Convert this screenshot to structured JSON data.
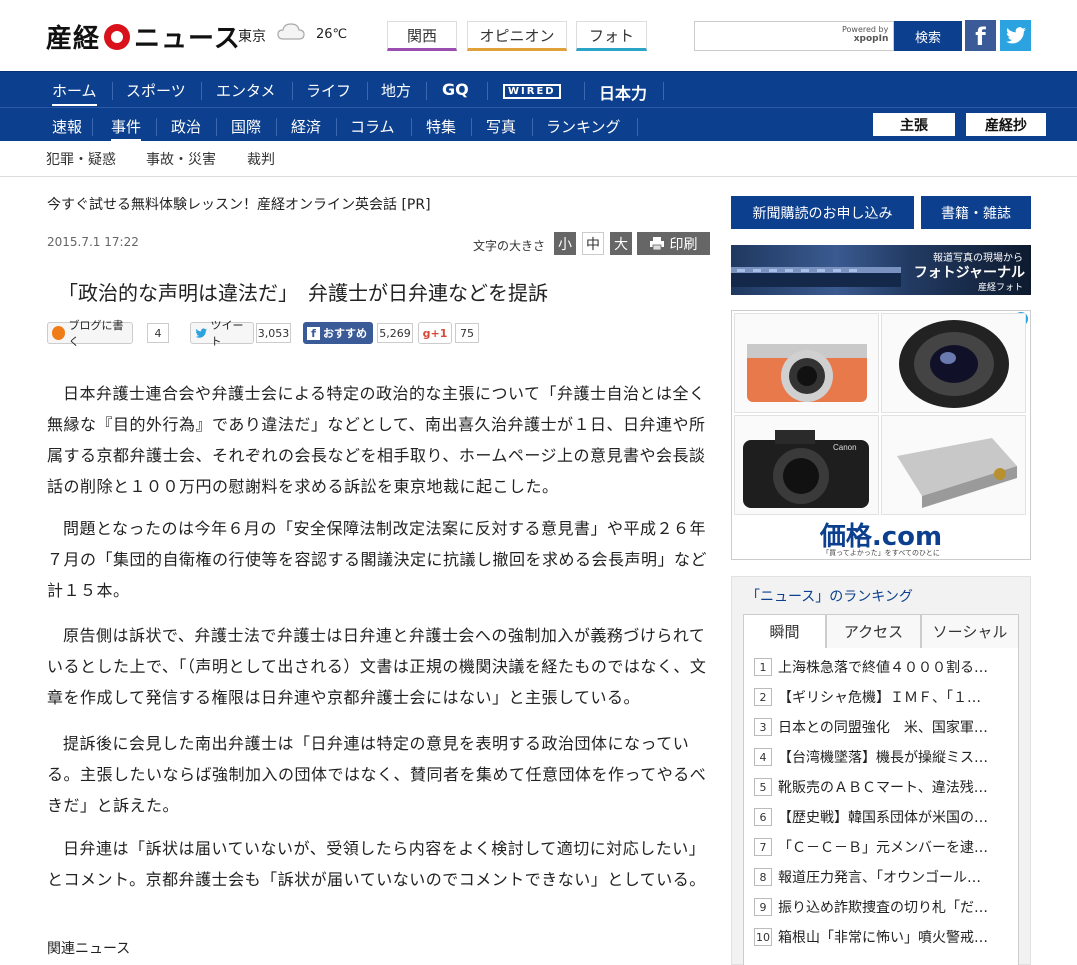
{
  "header": {
    "logo": "産経ニュース",
    "city": "東京",
    "temperature": "26℃",
    "weather_icon": "cloud-icon",
    "region_buttons": [
      "関西",
      "オピニオン",
      "フォト"
    ],
    "search_powered": "Powered by\nxpopIn",
    "search_button": "検索",
    "social": [
      "facebook-icon",
      "twitter-icon"
    ]
  },
  "nav1": [
    "ホーム",
    "スポーツ",
    "エンタメ",
    "ライフ",
    "地方",
    "GQ",
    "WIRED",
    "日本力"
  ],
  "nav2": [
    "速報",
    "事件",
    "政治",
    "国際",
    "経済",
    "コラム",
    "特集",
    "写真",
    "ランキング"
  ],
  "nav2_right": [
    "主張",
    "産経抄"
  ],
  "subnav": [
    "犯罪・疑惑",
    "事故・災害",
    "裁判"
  ],
  "article": {
    "pr": "今すぐ試せる無料体験レッスン！産経オンライン英会話 [PR]",
    "date": "2015.7.1 17:22",
    "fontsize_label": "文字の大きさ",
    "fontsize_buttons": [
      "小",
      "中",
      "大"
    ],
    "print": "印刷",
    "headline": "「政治的な声明は違法だ」　弁護士が日弁連などを提訴",
    "share": {
      "blog": "ブログに書く",
      "blog_count": "4",
      "tweet": "ツイート",
      "tweet_count": "3,053",
      "fb": "おすすめ",
      "fb_count": "5,269",
      "gplus": "g+1",
      "gplus_count": "75"
    },
    "paragraphs": [
      "日本弁護士連合会や弁護士会による特定の政治的な主張について「弁護士自治とは全く無縁な『目的外行為』であり違法だ」などとして、南出喜久治弁護士が１日、日弁連や所属する京都弁護士会、それぞれの会長などを相手取り、ホームページ上の意見書や会長談話の削除と１００万円の慰謝料を求める訴訟を東京地裁に起こした。",
      "問題となったのは今年６月の「安全保障法制改定法案に反対する意見書」や平成２６年７月の「集団的自衛権の行使等を容認する閣議決定に抗議し撤回を求める会長声明」など計１５本。",
      "原告側は訴状で、弁護士法で弁護士は日弁連と弁護士会への強制加入が義務づけられているとした上で、「（声明として出される）文書は正規の機関決議を経たものではなく、文章を作成して発信する権限は日弁連や京都弁護士会にはない」と主張している。",
      "提訴後に会見した南出弁護士は「日弁連は特定の意見を表明する政治団体になっている。主張したいならば強制加入の団体ではなく、賛同者を集めて任意団体を作ってやるべきだ」と訴えた。",
      "日弁連は「訴状は届いていないが、受領したら内容をよく検討して適切に対応したい」とコメント。京都弁護士会も「訴状が届いていないのでコメントできない」としている。"
    ],
    "related": "関連ニュース"
  },
  "sidebar": {
    "subscribe": "新聞購読のお申し込み",
    "books": "書籍・雑誌",
    "photo_banner": {
      "line1": "報道写真の現場から",
      "line2": "フォトジャーナル",
      "line3": "産経フォト"
    },
    "ad": {
      "logo": "価格.com",
      "tagline": "「買ってよかった」をすべてのひとに",
      "info": "i"
    },
    "ranking": {
      "title": "「ニュース」のランキング",
      "tabs": [
        "瞬間",
        "アクセス",
        "ソーシャル"
      ],
      "items": [
        "上海株急落で終値４０００割る…",
        "【ギリシャ危機】ＩＭＦ、「１…",
        "日本との同盟強化　米、国家軍…",
        "【台湾機墜落】機長が操縦ミス…",
        "靴販売のＡＢＣマート、違法残…",
        "【歴史戦】韓国系団体が米国の…",
        "「Ｃ－Ｃ－Ｂ」元メンバーを逮…",
        "報道圧力発言、「オウンゴール…",
        "振り込め詐欺捜査の切り札「だ…",
        "箱根山「非常に怖い」噴火警戒…"
      ]
    }
  }
}
